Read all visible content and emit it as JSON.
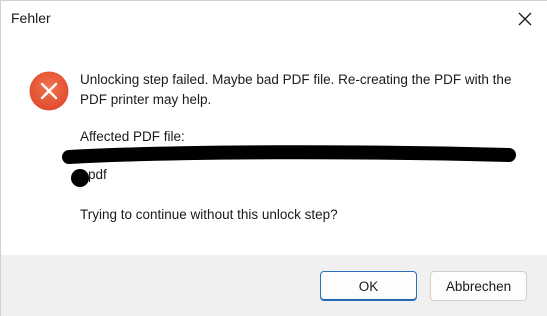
{
  "window": {
    "title": "Fehler",
    "close_icon": "close-icon"
  },
  "message": {
    "icon": "error-icon",
    "icon_color": "#e8553b",
    "text": "Unlocking step failed. Maybe bad PDF file. Re-creating the PDF with the PDF printer may help.",
    "affected_label": "Affected PDF file:",
    "file_extension": "pdf",
    "question": "Trying to continue without this unlock step?"
  },
  "buttons": {
    "ok_label": "OK",
    "cancel_label": "Abbrechen"
  },
  "colors": {
    "accent": "#2b6fbf",
    "footer_bg": "#f0f0f0"
  }
}
